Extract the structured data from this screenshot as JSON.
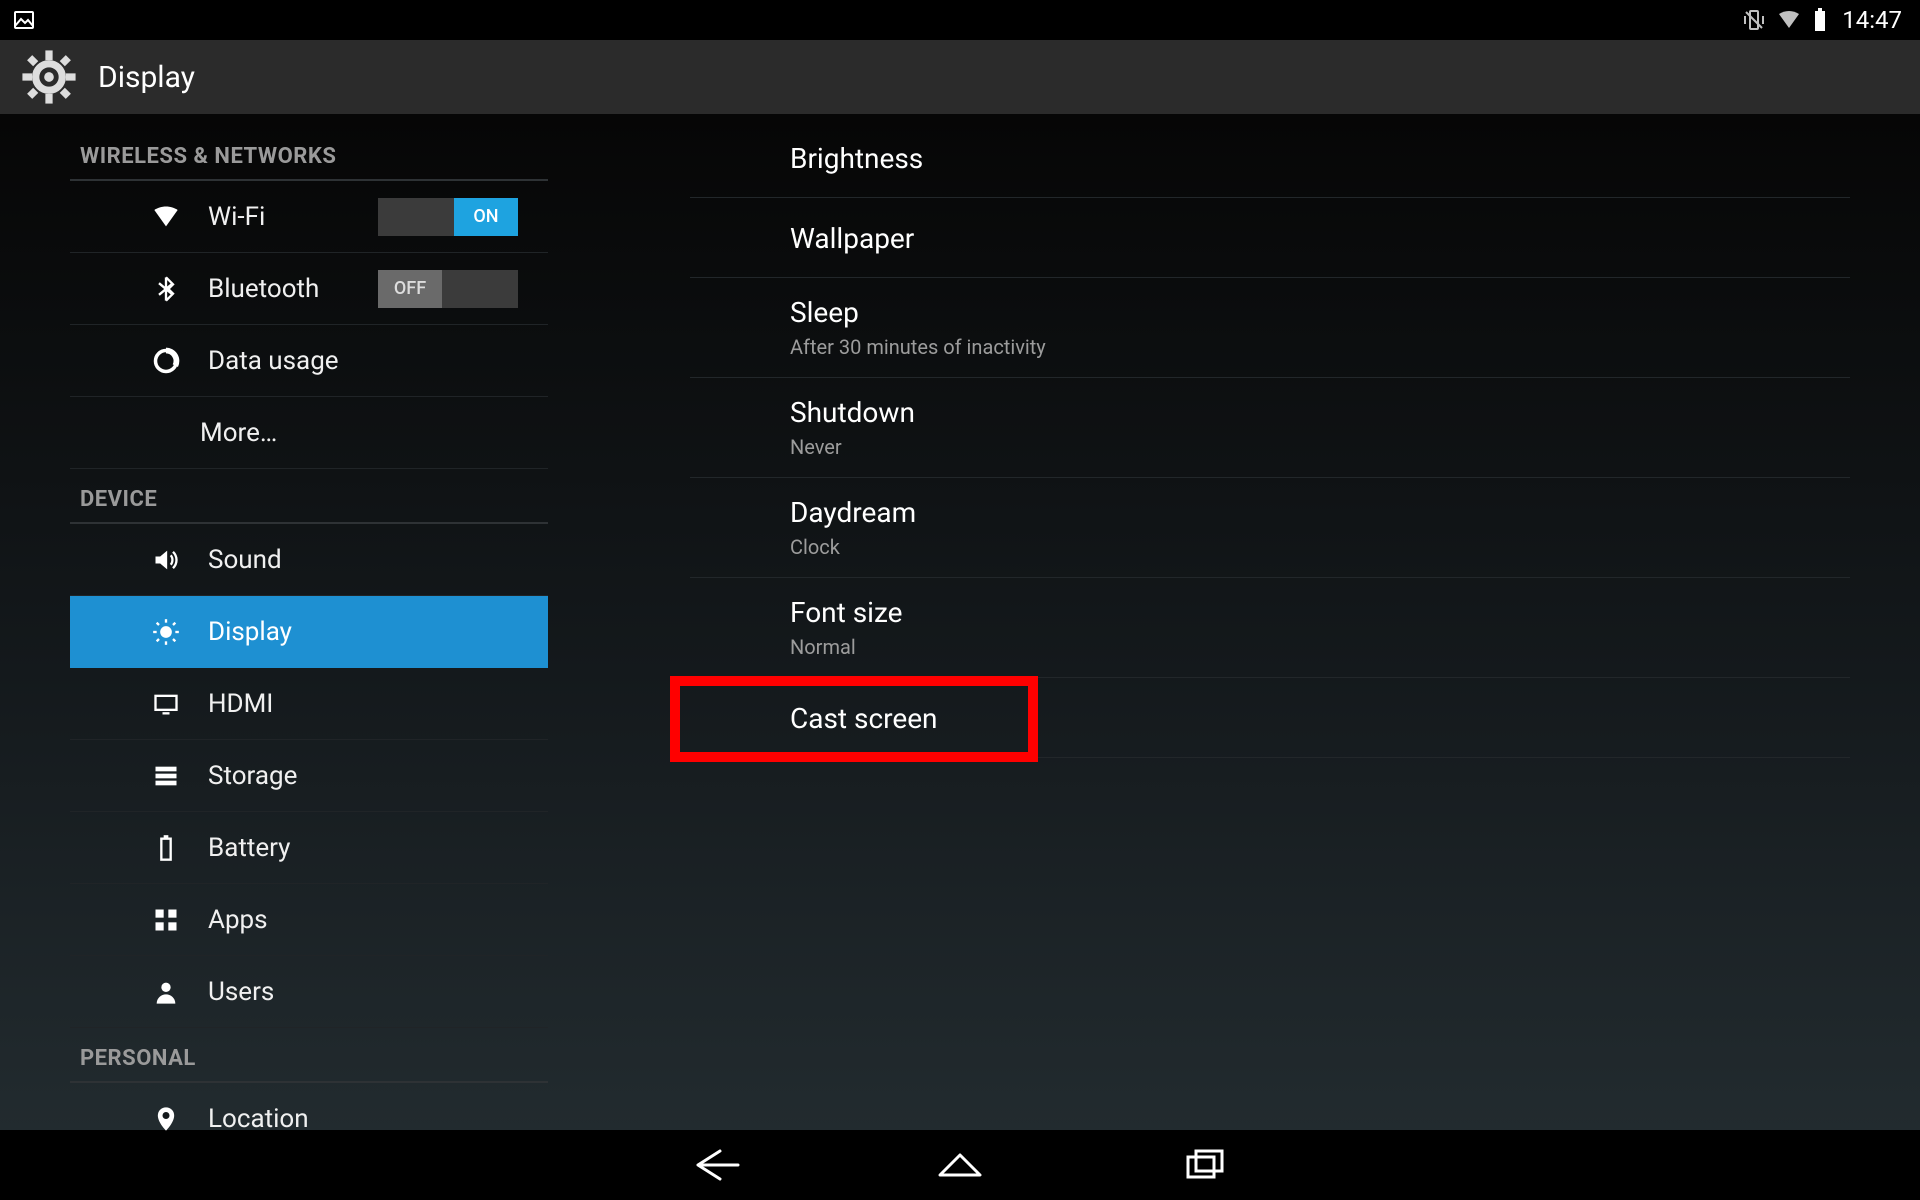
{
  "statusbar": {
    "clock": "14:47"
  },
  "actionbar": {
    "title": "Display"
  },
  "sidebar": {
    "sections": [
      {
        "header": "WIRELESS & NETWORKS",
        "items": [
          {
            "id": "wifi",
            "label": "Wi-Fi",
            "toggle": {
              "state": "ON"
            }
          },
          {
            "id": "bluetooth",
            "label": "Bluetooth",
            "toggle": {
              "state": "OFF"
            }
          },
          {
            "id": "datausage",
            "label": "Data usage"
          },
          {
            "id": "more",
            "label": "More…"
          }
        ]
      },
      {
        "header": "DEVICE",
        "items": [
          {
            "id": "sound",
            "label": "Sound"
          },
          {
            "id": "display",
            "label": "Display",
            "selected": true
          },
          {
            "id": "hdmi",
            "label": "HDMI"
          },
          {
            "id": "storage",
            "label": "Storage"
          },
          {
            "id": "battery",
            "label": "Battery"
          },
          {
            "id": "apps",
            "label": "Apps"
          },
          {
            "id": "users",
            "label": "Users"
          }
        ]
      },
      {
        "header": "PERSONAL",
        "items": [
          {
            "id": "location",
            "label": "Location"
          }
        ]
      }
    ]
  },
  "main": {
    "rows": [
      {
        "id": "brightness",
        "title": "Brightness"
      },
      {
        "id": "wallpaper",
        "title": "Wallpaper"
      },
      {
        "id": "sleep",
        "title": "Sleep",
        "sub": "After 30 minutes of inactivity"
      },
      {
        "id": "shutdown",
        "title": "Shutdown",
        "sub": "Never"
      },
      {
        "id": "daydream",
        "title": "Daydream",
        "sub": "Clock"
      },
      {
        "id": "fontsize",
        "title": "Font size",
        "sub": "Normal"
      },
      {
        "id": "castscreen",
        "title": "Cast screen",
        "highlighted": true
      }
    ]
  },
  "toggle_labels": {
    "on": "ON",
    "off": "OFF"
  }
}
